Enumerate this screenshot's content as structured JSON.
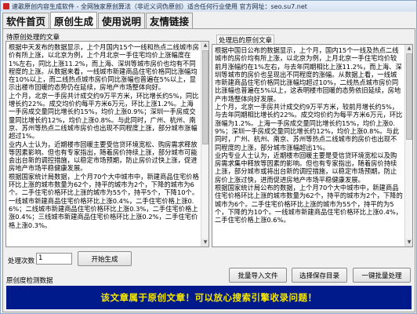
{
  "window": {
    "title": "速歌原创内容生成软件 - 全网独家原创算法（非近义词伪原创）适合任何行业使用 官方网址：seo.su7.net"
  },
  "tabs": [
    {
      "label": "软件首页",
      "active": false
    },
    {
      "label": "原创生成",
      "active": true
    },
    {
      "label": "使用说明",
      "active": false
    },
    {
      "label": "友情链接",
      "active": false
    }
  ],
  "left_panel": {
    "label": "待原创处理的文章",
    "text": "根据中天发布的数据显示，上个月国内15个一线和热点二线城市房价有所上涨，以北京为例，上个月北京一手住宅均价上涨幅度在1%左右，同比上涨11.2%，而上海、深圳等城市房价也均有不同程度的上涨。从数据来看，一线城市新建商品住宅价格同比涨幅均在10%以上，而二线热点城市房价同比涨幅也普遍在5%以上，显示出楼市回暖的态势仍在延续，房地产市场整体向好。\n上个月，北京一手房共计成交约9万平方米，环比增长约5%，同比增长约22%。成交均价约每平方米6万元，环比上涨1.2%。上海一手房成交量同比增长约15%，均价上涨0.9%；深圳一手房成交量同比增长约12%，均价上涨0.8%。与此同时，广州、杭州、南京、苏州等热点二线城市房价也出现不同程度上涨，部分城市涨幅超过1%。\n业内人士认为，近期楼市回暖主要受信贷环境宽松、购房需求释放等因素影响。但也有专家指出，随着房价持续上涨，部分城市可能会出台新的调控措施，以稳定市场预期，防止房价过快上涨，促进房地产市场平稳健康发展。\n根据国家统计局数据，上个月70个大中城市中，新建商品住宅价格环比上涨的城市数量为62个，持平的城市为2个，下降的城市为6个。二手住宅价格环比上涨的城市为55个，持平5个，下降10个。一线城市新建商品住宅价格环比上涨0.4%，二手住宅价格上涨0.6%；二线城市新建商品住宅价格环比上涨0.3%，二手住宅价格上涨0.4%；三线城市新建商品住宅价格环比上涨0.2%，二手住宅价格上涨0.3%。"
  },
  "right_panel": {
    "label": "处理后的原创文章",
    "text": "根据中国日公布的数据显示，上个月，国内15个一线及热点二线城市的房价均有所上涨，以北京为例，上月北京一手住宅均价较前月涨幅约在1%左右，与去年同期相比上涨11.2%，而上海、深圳等城市的房价也呈现出不同程度的涨幅。从数据上看，一线城市新建商品住宅价格同比涨幅均超过10%，二线热点城市房价同比涨幅也普遍在5%以上，这表明楼市回暖的态势依旧延续，房地产市场整体向好发展。\n上个月，北京一手房共计成交约9万平方米，较前月增长约5%，与去年同期相比增长约22%。成交均价约为每平方米6万元，环比涨幅为1.2%。上海一手房成交量同比增长约15%，均价上涨0.9%；深圳一手房成交量同比增长约12%，均价上涨0.8%。与此同时，广州、杭州、南京、苏州等热点二线城市的房价也出现不同程度的上涨，部分城市涨幅超出1%。\n业内专业人士认为，近期楼市回暖主要是受信贷环境宽松以及购房需求集中释放等因素的影响。但也有专家指出，随着房价持续上涨，部分城市或将出台新的调控措施，以稳定市场预期，防止房价上涨过快，进而促进房地产市场平稳健康发展。\n根据国家统计局公布的数据，上个月70个大中城市中，新建商品住宅价格环比上涨的城市数量为62个，持平的城市为2个，下降的城市为6个。二手住宅价格环比上涨的城市为55个，持平的为5个，下降的为10个。一线城市新建商品住宅价格环比上涨0.4%，二手住宅价格上涨0.6%。"
  },
  "controls": {
    "process_count_label": "处理次数",
    "process_count_value": "1",
    "start_button": "开始生成",
    "batch_import_button": "批量导入文件",
    "select_save_dir_button": "选择保存目录",
    "batch_process_button": "一键批量处理",
    "detection_label": "原创度检测数据"
  },
  "result": {
    "message": "该文章属于原创文章！可以放心搜索引擎收录问题！",
    "text_color": "#f5e600",
    "background_color": "#001a8c"
  }
}
